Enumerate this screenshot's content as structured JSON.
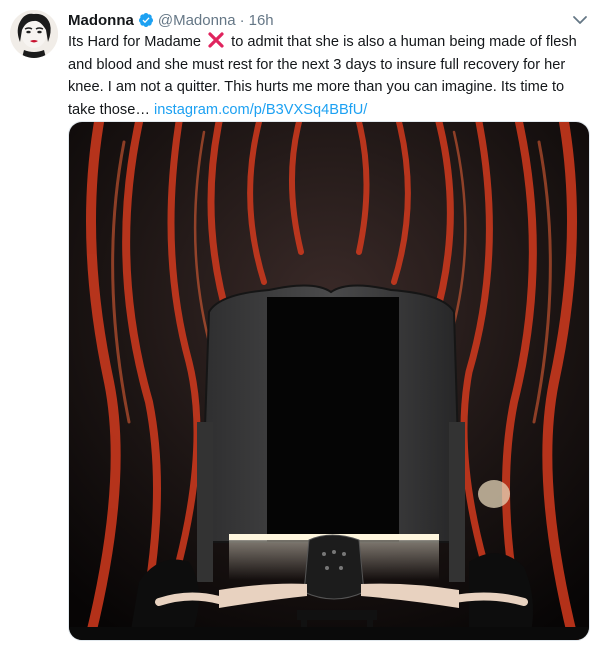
{
  "tweet": {
    "author_name": "Madonna",
    "handle": "@Madonna",
    "separator": "·",
    "time": "16h",
    "text_part1": "Its Hard for Madame",
    "text_part2": "to admit that she is also a human being made of flesh and blood and she must rest for the next 3 days to insure full recovery for her knee. I am not a quitter. This hurts me more than you can imagine. Its time to take those…",
    "link_text": "instagram.com/p/B3VXSq4BBfU/"
  },
  "icons": {
    "verified": "verified-badge-icon",
    "emoji": "cross-mark-emoji-icon",
    "caret": "chevron-down-icon"
  },
  "colors": {
    "link": "#1da1f2",
    "verified": "#1da1f2",
    "handle": "#657786",
    "emoji": "#e0245e"
  }
}
